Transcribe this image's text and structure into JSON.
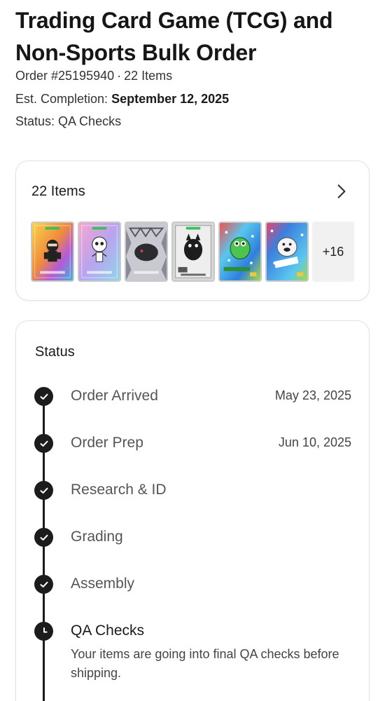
{
  "header": {
    "title": "Trading Card Game (TCG) and Non-Sports Bulk Order",
    "order_number": "Order #25195940",
    "separator": "·",
    "item_count": "22 Items",
    "completion_label": "Est. Completion:",
    "completion_date": "September 12, 2025",
    "status_label": "Status:",
    "status_value": "QA Checks"
  },
  "items_card": {
    "title": "22 Items",
    "chevron_icon": "chevron-right-icon",
    "thumbnails": [
      {
        "name": "card-ninja-thumbnail",
        "color": "#f4b63a"
      },
      {
        "name": "card-skeleton-thumbnail",
        "color": "#c9a7e6"
      },
      {
        "name": "card-dark-creature-thumbnail",
        "color": "#5a5a66"
      },
      {
        "name": "card-cat-thumbnail",
        "color": "#9a9a9a"
      },
      {
        "name": "card-green-monster-thumbnail",
        "color": "#62c3e8"
      },
      {
        "name": "card-bulldog-thumbnail",
        "color": "#3f7fd9"
      }
    ],
    "more_label": "+16"
  },
  "status_card": {
    "title": "Status",
    "steps": [
      {
        "label": "Order Arrived",
        "date": "May 23, 2025",
        "state": "done"
      },
      {
        "label": "Order Prep",
        "date": "Jun 10, 2025",
        "state": "done"
      },
      {
        "label": "Research & ID",
        "date": "",
        "state": "done"
      },
      {
        "label": "Grading",
        "date": "",
        "state": "done"
      },
      {
        "label": "Assembly",
        "date": "",
        "state": "done"
      },
      {
        "label": "QA Checks",
        "date": "",
        "state": "current",
        "description": "Your items are going into final QA checks before shipping."
      }
    ]
  },
  "colors": {
    "text_primary": "#1a1a1a",
    "text_secondary": "#555555",
    "timeline": "#1c1c1c",
    "card_border": "#e2e2e2"
  }
}
